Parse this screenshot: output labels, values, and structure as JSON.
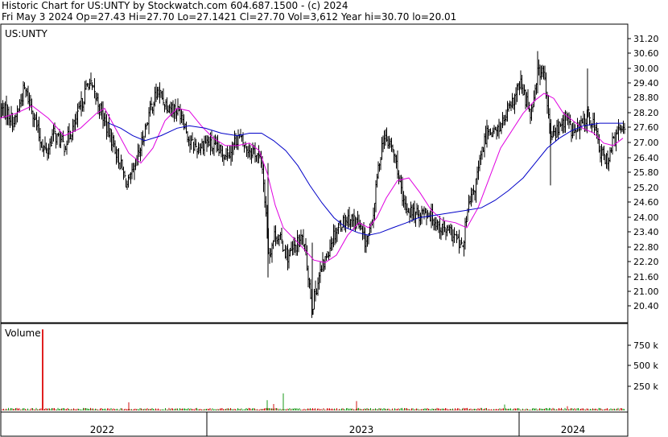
{
  "header": {
    "line1": "Historic Chart for US:UNTY by Stockwatch.com 604.687.1500 - (c) 2024",
    "line2": "Fri May  3 2024   Op=27.43  Hi=27.70  Lo=27.1421  Cl=27.70  Vol=3,612  Year hi=30.70  lo=20.01"
  },
  "colors": {
    "price_bar": "#000000",
    "ma_short": "#e000e0",
    "ma_long": "#0000c8",
    "volume_up": "#1a9a1a",
    "volume_down": "#d01010",
    "volume_spike": "#e02020",
    "frame": "#000000"
  },
  "chart_data": [
    {
      "type": "line",
      "title": "US:UNTY",
      "description_series": "daily OHLC bars with two moving averages",
      "ylim": [
        19.8,
        31.5
      ],
      "yticks": [
        "31.20",
        "30.60",
        "30.00",
        "29.40",
        "28.80",
        "28.20",
        "27.60",
        "27.00",
        "26.40",
        "25.80",
        "25.20",
        "24.60",
        "24.00",
        "23.40",
        "22.80",
        "22.20",
        "21.60",
        "21.00",
        "20.40"
      ],
      "x_labels": [
        "2022",
        "2023",
        "2024"
      ],
      "grid": false,
      "series": [
        {
          "name": "",
          "role": "close_approx",
          "points": [
            [
              0,
              28.4
            ],
            [
              10,
              28.2
            ],
            [
              18,
              27.8
            ],
            [
              30,
              29.2
            ],
            [
              40,
              28.4
            ],
            [
              50,
              27.1
            ],
            [
              58,
              26.6
            ],
            [
              66,
              27.4
            ],
            [
              80,
              26.9
            ],
            [
              95,
              27.9
            ],
            [
              110,
              29.5
            ],
            [
              122,
              28.6
            ],
            [
              132,
              27.7
            ],
            [
              142,
              26.9
            ],
            [
              150,
              26.1
            ],
            [
              158,
              25.3
            ],
            [
              166,
              25.8
            ],
            [
              176,
              27.0
            ],
            [
              186,
              28.3
            ],
            [
              196,
              29.1
            ],
            [
              206,
              28.6
            ],
            [
              216,
              28.4
            ],
            [
              226,
              28.2
            ],
            [
              236,
              27.0
            ],
            [
              246,
              26.8
            ],
            [
              256,
              27.1
            ],
            [
              266,
              26.8
            ],
            [
              276,
              26.6
            ],
            [
              286,
              26.7
            ],
            [
              296,
              27.3
            ],
            [
              306,
              26.8
            ],
            [
              316,
              26.7
            ],
            [
              326,
              26.1
            ],
            [
              334,
              22.5
            ],
            [
              342,
              23.4
            ],
            [
              350,
              23.0
            ],
            [
              358,
              22.4
            ],
            [
              366,
              22.8
            ],
            [
              376,
              23.2
            ],
            [
              382,
              22.0
            ],
            [
              388,
              20.4
            ],
            [
              396,
              21.6
            ],
            [
              404,
              22.3
            ],
            [
              414,
              23.3
            ],
            [
              424,
              23.8
            ],
            [
              434,
              24.0
            ],
            [
              444,
              23.8
            ],
            [
              454,
              23.0
            ],
            [
              462,
              23.6
            ],
            [
              470,
              26.0
            ],
            [
              476,
              27.2
            ],
            [
              486,
              26.9
            ],
            [
              494,
              26.0
            ],
            [
              500,
              24.6
            ],
            [
              508,
              24.3
            ],
            [
              518,
              24.1
            ],
            [
              528,
              24.3
            ],
            [
              538,
              24.0
            ],
            [
              548,
              23.6
            ],
            [
              558,
              23.4
            ],
            [
              566,
              23.2
            ],
            [
              574,
              22.7
            ],
            [
              582,
              24.4
            ],
            [
              590,
              25.2
            ],
            [
              598,
              26.5
            ],
            [
              606,
              27.6
            ],
            [
              616,
              27.4
            ],
            [
              626,
              27.9
            ],
            [
              636,
              28.5
            ],
            [
              646,
              29.4
            ],
            [
              654,
              28.7
            ],
            [
              660,
              28.2
            ],
            [
              668,
              29.9
            ],
            [
              676,
              29.8
            ],
            [
              684,
              27.2
            ],
            [
              694,
              27.6
            ],
            [
              704,
              28.0
            ],
            [
              712,
              27.4
            ],
            [
              720,
              27.6
            ],
            [
              730,
              28.1
            ],
            [
              738,
              27.8
            ],
            [
              746,
              26.6
            ],
            [
              754,
              26.3
            ],
            [
              760,
              26.9
            ],
            [
              768,
              27.4
            ],
            [
              774,
              27.7
            ]
          ]
        },
        {
          "name": "",
          "role": "moving_average_short",
          "points": [
            [
              0,
              28.0
            ],
            [
              20,
              28.2
            ],
            [
              40,
              28.5
            ],
            [
              60,
              28.0
            ],
            [
              80,
              27.3
            ],
            [
              100,
              27.6
            ],
            [
              120,
              28.2
            ],
            [
              130,
              28.4
            ],
            [
              145,
              27.5
            ],
            [
              160,
              26.6
            ],
            [
              175,
              26.2
            ],
            [
              190,
              26.8
            ],
            [
              205,
              27.9
            ],
            [
              220,
              28.4
            ],
            [
              235,
              28.3
            ],
            [
              250,
              27.7
            ],
            [
              265,
              27.2
            ],
            [
              280,
              26.9
            ],
            [
              295,
              26.9
            ],
            [
              310,
              27.0
            ],
            [
              322,
              26.7
            ],
            [
              332,
              25.8
            ],
            [
              342,
              24.5
            ],
            [
              352,
              23.6
            ],
            [
              364,
              23.2
            ],
            [
              376,
              22.8
            ],
            [
              390,
              22.3
            ],
            [
              404,
              22.2
            ],
            [
              418,
              22.5
            ],
            [
              432,
              23.3
            ],
            [
              446,
              23.8
            ],
            [
              458,
              23.6
            ],
            [
              468,
              24.0
            ],
            [
              480,
              24.8
            ],
            [
              494,
              25.5
            ],
            [
              508,
              25.6
            ],
            [
              522,
              25.0
            ],
            [
              536,
              24.3
            ],
            [
              550,
              23.9
            ],
            [
              566,
              23.8
            ],
            [
              580,
              23.6
            ],
            [
              594,
              24.4
            ],
            [
              608,
              25.6
            ],
            [
              622,
              26.8
            ],
            [
              636,
              27.5
            ],
            [
              650,
              28.2
            ],
            [
              664,
              28.7
            ],
            [
              676,
              29.0
            ],
            [
              688,
              28.8
            ],
            [
              700,
              28.2
            ],
            [
              712,
              27.9
            ],
            [
              724,
              27.6
            ],
            [
              738,
              27.4
            ],
            [
              750,
              27.0
            ],
            [
              762,
              26.9
            ],
            [
              774,
              27.2
            ]
          ]
        },
        {
          "name": "",
          "role": "moving_average_long",
          "points": [
            [
              135,
              27.8
            ],
            [
              150,
              27.6
            ],
            [
              165,
              27.3
            ],
            [
              180,
              27.1
            ],
            [
              200,
              27.3
            ],
            [
              220,
              27.6
            ],
            [
              235,
              27.7
            ],
            [
              255,
              27.6
            ],
            [
              275,
              27.4
            ],
            [
              295,
              27.3
            ],
            [
              310,
              27.4
            ],
            [
              325,
              27.4
            ],
            [
              340,
              27.1
            ],
            [
              355,
              26.7
            ],
            [
              370,
              26.1
            ],
            [
              385,
              25.3
            ],
            [
              400,
              24.6
            ],
            [
              415,
              24.0
            ],
            [
              430,
              23.6
            ],
            [
              445,
              23.4
            ],
            [
              458,
              23.3
            ],
            [
              472,
              23.4
            ],
            [
              488,
              23.6
            ],
            [
              505,
              23.8
            ],
            [
              520,
              24.0
            ],
            [
              540,
              24.1
            ],
            [
              560,
              24.2
            ],
            [
              580,
              24.3
            ],
            [
              598,
              24.4
            ],
            [
              615,
              24.7
            ],
            [
              632,
              25.1
            ],
            [
              650,
              25.6
            ],
            [
              665,
              26.2
            ],
            [
              680,
              26.8
            ],
            [
              695,
              27.2
            ],
            [
              710,
              27.5
            ],
            [
              725,
              27.7
            ],
            [
              745,
              27.8
            ],
            [
              760,
              27.8
            ],
            [
              774,
              27.8
            ]
          ]
        }
      ]
    },
    {
      "type": "bar",
      "title": "Volume",
      "yticks": [
        "750 k",
        "500 k",
        "250 k"
      ],
      "ylim": [
        0,
        1000000
      ],
      "spike": {
        "x": 53,
        "value": 950000
      },
      "notable_bars": [
        [
          160,
          95000
        ],
        [
          332,
          120000
        ],
        [
          340,
          75000
        ],
        [
          352,
          200000
        ],
        [
          443,
          110000
        ],
        [
          627,
          70000
        ],
        [
          705,
          50000
        ]
      ]
    }
  ]
}
